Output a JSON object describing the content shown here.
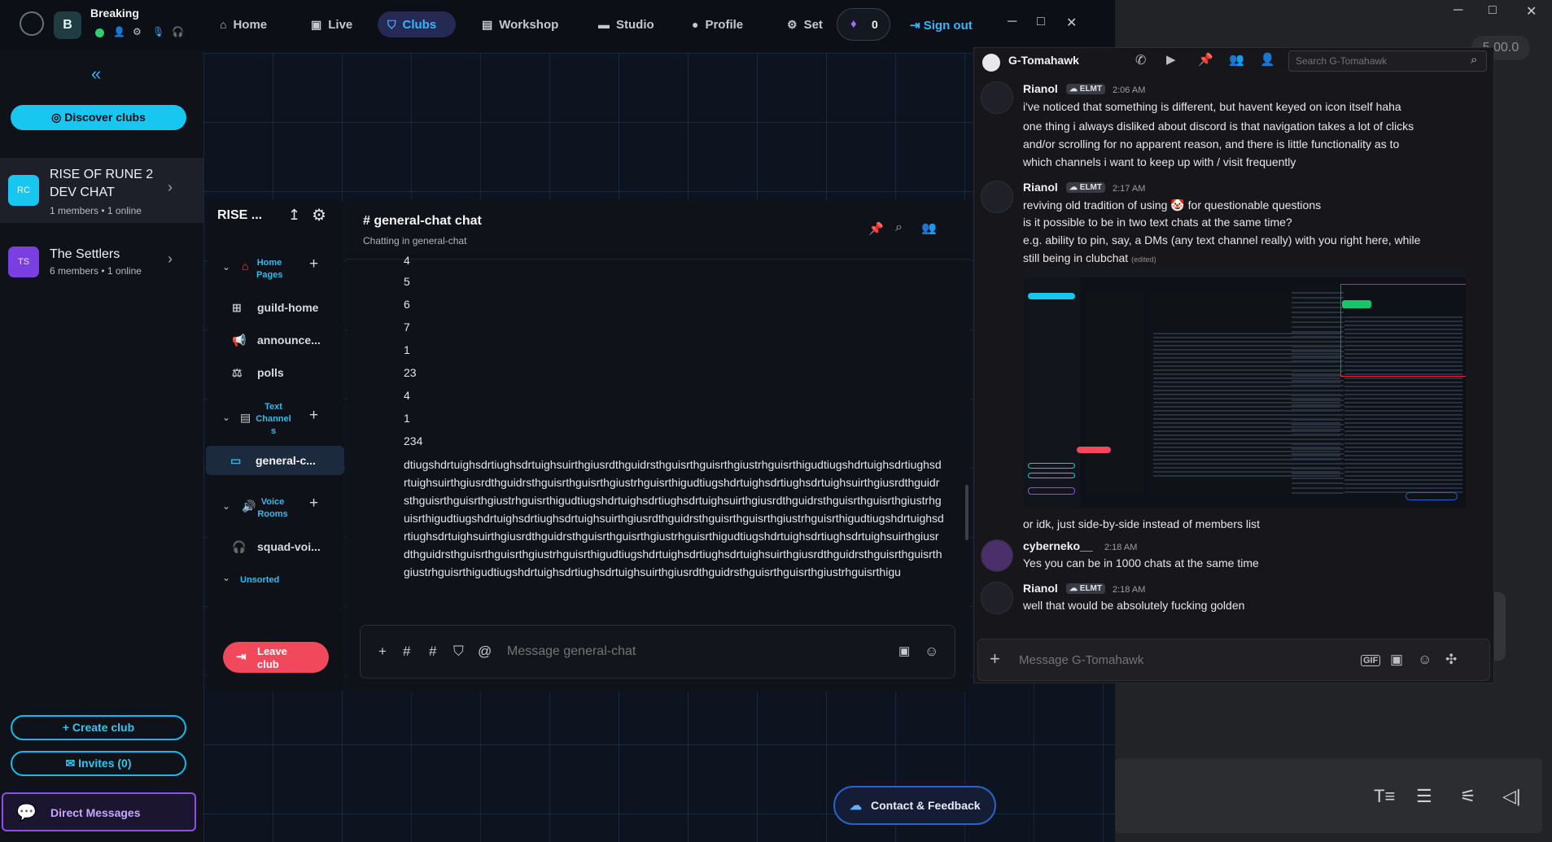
{
  "app": {
    "user_initial": "B",
    "username": "Breaking",
    "nav": [
      {
        "label": "Home",
        "icon": "home-icon"
      },
      {
        "label": "Live",
        "icon": "tv-icon"
      },
      {
        "label": "Clubs",
        "icon": "shield-icon",
        "active": true
      },
      {
        "label": "Workshop",
        "icon": "workshop-icon"
      },
      {
        "label": "Studio",
        "icon": "camera-icon"
      },
      {
        "label": "Profile",
        "icon": "user-icon"
      },
      {
        "label": "Set",
        "icon": "gear-icon"
      }
    ],
    "credits": "0",
    "sign_out": "Sign out"
  },
  "sidebar": {
    "discover": "Discover clubs",
    "clubs": [
      {
        "initials": "RC",
        "name_line1": "RISE OF RUNE 2",
        "name_line2": "DEV CHAT",
        "meta": "1 members • 1 online",
        "color": "#17c7ef"
      },
      {
        "initials": "TS",
        "name_line1": "The Settlers",
        "meta": "6 members • 1 online",
        "color": "#7a3fe0"
      }
    ],
    "create_club": "Create club",
    "invites": "Invites (0)",
    "direct_messages": "Direct Messages"
  },
  "channels": {
    "club_short": "RISE ...",
    "cat_home": "Home\nPages",
    "cat_text": "Text\nChannel\ns",
    "cat_voice": "Voice\nRooms",
    "cat_unsorted": "Unsorted",
    "items": {
      "guild_home": "guild-home",
      "announce": "announce...",
      "polls": "polls",
      "general": "general-c...",
      "squad": "squad-voi..."
    },
    "leave": "Leave\nclub"
  },
  "chat": {
    "title": "# general-chat chat",
    "subtitle": "Chatting in general-chat",
    "lines": [
      "4",
      "5",
      "6",
      "7",
      "1",
      "23",
      "4",
      "1",
      "234"
    ],
    "long": "dtiugshdrtuighsdrtiughsdrtuighsuirthgiusrdthguidrsthguisrthguisrthgiustrhguisrthigudtiugshdrtuighsdrtiughsdrtuighsuirthgiusrdthguidrsthguisrthguisrthgiustrhguisrthigudtiugshdrtuighsdrtiughsdrtuighsuirthgiusrdthguidrsthguisrthguisrthgiustrhguisrthigudtiugshdrtuighsdrtiughsdrtuighsuirthgiusrdthguidrsthguisrthguisrthgiustrhguisrthigudtiugshdrtuighsdrtiughsdrtuighsuirthgiusrdthguidrsthguisrthguisrthgiustrhguisrthigudtiugshdrtuighsdrtiughsdrtuighsuirthgiusrdthguidrsthguisrthguisrthgiustrhguisrthigudtiugshdrtuighsdrtiughsdrtuighsuirthgiusrdthguidrsthguisrthguisrthgiustrhguisrthigudtiugshdrtuighsdrtiughsdrtuighsuirthgiusrdthguidrsthguisrthguisrthgiustrhguisrthigudtiugshdrtuighsdrtiughsdrtuighsuirthgiusrdthguidrsthguisrthguisrthgiustrhguisrthigu",
    "placeholder": "Message general-chat"
  },
  "contact": "Contact & Feedback",
  "dm": {
    "title": "G-Tomahawk",
    "search_placeholder": "Search G-Tomahawk",
    "messages": [
      {
        "author": "Rianol",
        "badge": "ELMT",
        "time": "2:06 AM",
        "lines": [
          "i've noticed that something is different, but havent keyed on icon itself haha",
          "one thing i always disliked about discord is that navigation takes a lot of clicks",
          "and/or scrolling for no apparent reason, and there is little functionality as to",
          "which channels i want to keep up with / visit frequently"
        ]
      },
      {
        "author": "Rianol",
        "badge": "ELMT",
        "time": "2:17 AM",
        "lines": [
          "reviving old tradition of using",
          "for questionable questions",
          "is it possible to be in two text chats at the same time?",
          "e.g. ability to pin, say, a DMs (any text channel really) with you right here, while",
          "still being in clubchat"
        ],
        "edited": "(edited)"
      },
      {
        "lines": [
          "or idk, just side-by-side instead of members list"
        ]
      },
      {
        "author": "cyberneko__",
        "time": "2:18 AM",
        "lines": [
          "Yes you can be in 1000 chats at the same time"
        ]
      },
      {
        "author": "Rianol",
        "badge": "ELMT",
        "time": "2:18 AM",
        "lines": [
          "well that would be absolutely fucking golden"
        ]
      }
    ],
    "placeholder": "Message G-Tomahawk",
    "gif": "GIF"
  },
  "desktop": {
    "zoom": "5.00.0"
  }
}
